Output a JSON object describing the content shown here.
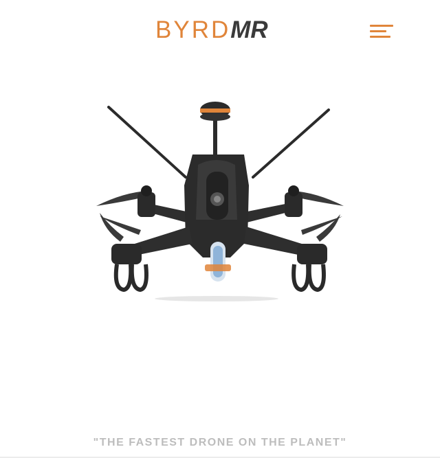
{
  "header": {
    "logo_part1": "BYRD",
    "logo_part2": "MR",
    "menu_icon": "hamburger-menu-icon"
  },
  "hero": {
    "image": "racing-drone"
  },
  "tagline": "\"THE FASTEST DRONE ON THE PLANET\"",
  "colors": {
    "accent": "#e0853a",
    "logo_dark": "#3a3a3a",
    "tagline": "#bdbdbd",
    "background": "#ffffff"
  }
}
